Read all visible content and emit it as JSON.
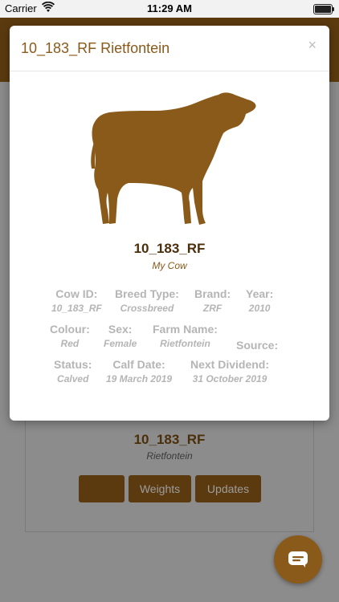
{
  "status_bar": {
    "carrier": "Carrier",
    "time": "11:29 AM"
  },
  "modal": {
    "title": "10_183_RF Rietfontein",
    "close": "×",
    "cow_name": "10_183_RF",
    "cow_subtitle": "My Cow",
    "fields": {
      "cow_id": {
        "label": "Cow ID:",
        "value": "10_183_RF"
      },
      "breed_type": {
        "label": "Breed Type:",
        "value": "Crossbreed"
      },
      "brand": {
        "label": "Brand:",
        "value": "ZRF"
      },
      "year": {
        "label": "Year:",
        "value": "2010"
      },
      "colour": {
        "label": "Colour:",
        "value": "Red"
      },
      "sex": {
        "label": "Sex:",
        "value": "Female"
      },
      "farm_name": {
        "label": "Farm Name:",
        "value": "Rietfontein"
      },
      "source": {
        "label": "Source:",
        "value": ""
      },
      "status": {
        "label": "Status:",
        "value": "Calved"
      },
      "calf_date": {
        "label": "Calf Date:",
        "value": "19 March 2019"
      },
      "next_dividend": {
        "label": "Next Dividend:",
        "value": "31 October 2019"
      }
    }
  },
  "background_card": {
    "name": "10_183_RF",
    "farm": "Rietfontein",
    "buttons": [
      "",
      "Weights",
      "Updates"
    ]
  },
  "icons": {
    "wifi": "wifi-icon",
    "battery": "battery-icon",
    "chat": "chat-icon",
    "cow": "cow-silhouette"
  },
  "colors": {
    "brand_brown": "#8a5a1a",
    "dark_brown": "#5b3a0f",
    "label_grey": "#b5b5b5"
  }
}
